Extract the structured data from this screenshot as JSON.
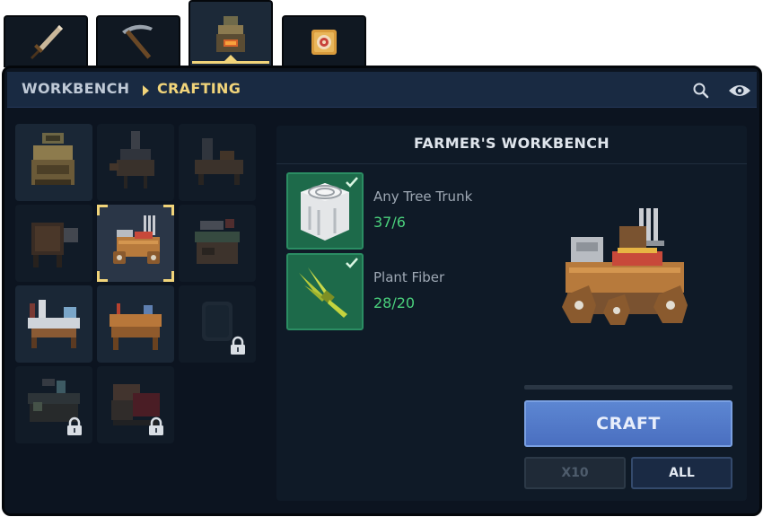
{
  "tabs": [
    {
      "name": "weapons",
      "icon": "sword-icon",
      "active": false
    },
    {
      "name": "tools",
      "icon": "pickaxe-icon",
      "active": false
    },
    {
      "name": "workbench",
      "icon": "workbench-icon",
      "active": true
    },
    {
      "name": "target",
      "icon": "target-icon",
      "active": false
    }
  ],
  "breadcrumb": {
    "first": "WORKBENCH",
    "second": "CRAFTING"
  },
  "actions": {
    "search_icon": "search-icon",
    "view_icon": "eye-icon"
  },
  "recipes": [
    {
      "id": "basic-workbench",
      "state": "available"
    },
    {
      "id": "forge",
      "state": "unavailable"
    },
    {
      "id": "tinker-bench",
      "state": "unavailable"
    },
    {
      "id": "loom",
      "state": "unavailable"
    },
    {
      "id": "farmers-workbench",
      "state": "selected"
    },
    {
      "id": "cooking-station",
      "state": "unavailable"
    },
    {
      "id": "alchemy-table",
      "state": "available"
    },
    {
      "id": "carpentry-bench",
      "state": "available"
    },
    {
      "id": "locked-recipe-1",
      "state": "locked"
    },
    {
      "id": "locked-recipe-2",
      "state": "locked"
    },
    {
      "id": "locked-recipe-3",
      "state": "locked"
    }
  ],
  "detail": {
    "title": "FARMER'S WORKBENCH",
    "ingredients": [
      {
        "name": "Any Tree Trunk",
        "count": "37/6",
        "icon": "tree-trunk-icon",
        "satisfied": true
      },
      {
        "name": "Plant Fiber",
        "count": "28/20",
        "icon": "plant-fiber-icon",
        "satisfied": true
      }
    ],
    "progress": 0,
    "craft_label": "CRAFT",
    "x10_label": "X10",
    "all_label": "ALL"
  },
  "colors": {
    "accent": "#f1d47a",
    "ok": "#4ad07c",
    "craft": "#5c86d2"
  }
}
